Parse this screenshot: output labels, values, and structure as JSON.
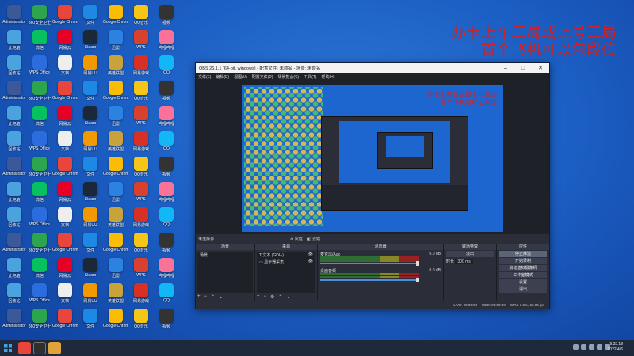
{
  "overlay_text": {
    "line1": "办卡上车三局或上号三局",
    "line2": "首个飞机可以包段位"
  },
  "desktop_icons": [
    {
      "label": "Administrator",
      "color": "#3b5998"
    },
    {
      "label": "360安全卫士",
      "color": "#2da44e"
    },
    {
      "label": "Google Chrome",
      "color": "#e8453c"
    },
    {
      "label": "文件",
      "color": "#1e88e5"
    },
    {
      "label": "Google Chrome",
      "color": "#fbbc05"
    },
    {
      "label": "QQ音乐",
      "color": "#f5c518"
    },
    {
      "label": "视频",
      "color": "#333333"
    },
    {
      "label": "此电脑",
      "color": "#4aa3df"
    },
    {
      "label": "微信",
      "color": "#07c160"
    },
    {
      "label": "网易云",
      "color": "#e60026"
    },
    {
      "label": "Steam",
      "color": "#1b2838"
    },
    {
      "label": "迅雷",
      "color": "#2c82e0"
    },
    {
      "label": "WPS",
      "color": "#d9412f"
    },
    {
      "label": "哔哩哔哩",
      "color": "#fb7299"
    },
    {
      "label": "回收站",
      "color": "#4aa3df"
    },
    {
      "label": "WPS Office",
      "color": "#2b6cdf"
    },
    {
      "label": "文档",
      "color": "#eeeeee"
    },
    {
      "label": "网易UU",
      "color": "#f29900"
    },
    {
      "label": "英雄联盟",
      "color": "#c8a23b"
    },
    {
      "label": "网易游戏",
      "color": "#d93025"
    },
    {
      "label": "QQ",
      "color": "#12b7f5"
    }
  ],
  "obs": {
    "title": "OBS 26.1.1 (64-bit, windows) - 配置文件: 未命名 - 场景: 未命名",
    "menu": [
      "文件(F)",
      "编辑(E)",
      "视图(V)",
      "配置文件(P)",
      "场景集合(S)",
      "工具(T)",
      "帮助(H)"
    ],
    "preview_overlay_1": "办卡上车三局或上号三局",
    "preview_overlay_2": "首个飞机可以包段位",
    "scene_bar": {
      "label": "未选择源",
      "props": "属性",
      "filters": "滤镜"
    },
    "docks": {
      "scenes": {
        "title": "场景",
        "items": [
          "场景"
        ]
      },
      "sources": {
        "title": "来源",
        "items": [
          "文本 (GDI+)",
          "显示器采集"
        ]
      },
      "mixer": {
        "title": "混音器",
        "rows": [
          {
            "name": "麦克风/Aux",
            "value": "0.0 dB"
          },
          {
            "name": "桌面音频",
            "value": "0.0 dB"
          }
        ]
      },
      "transitions": {
        "title": "转场特效",
        "type": "淡出",
        "duration_label": "时长",
        "duration": "300 ms"
      },
      "controls": {
        "title": "控件",
        "buttons": [
          "停止推流",
          "开始录制",
          "启动虚拟摄像机",
          "工作室模式",
          "设置",
          "退出"
        ]
      }
    },
    "status": {
      "live": "LIVE: 00:00:00",
      "rec": "REC: 00:00:00",
      "cpu": "CPU: 1.0%, 60.00 fps"
    }
  },
  "clock": {
    "time": "9:33:19",
    "date": "2022/4/6"
  }
}
